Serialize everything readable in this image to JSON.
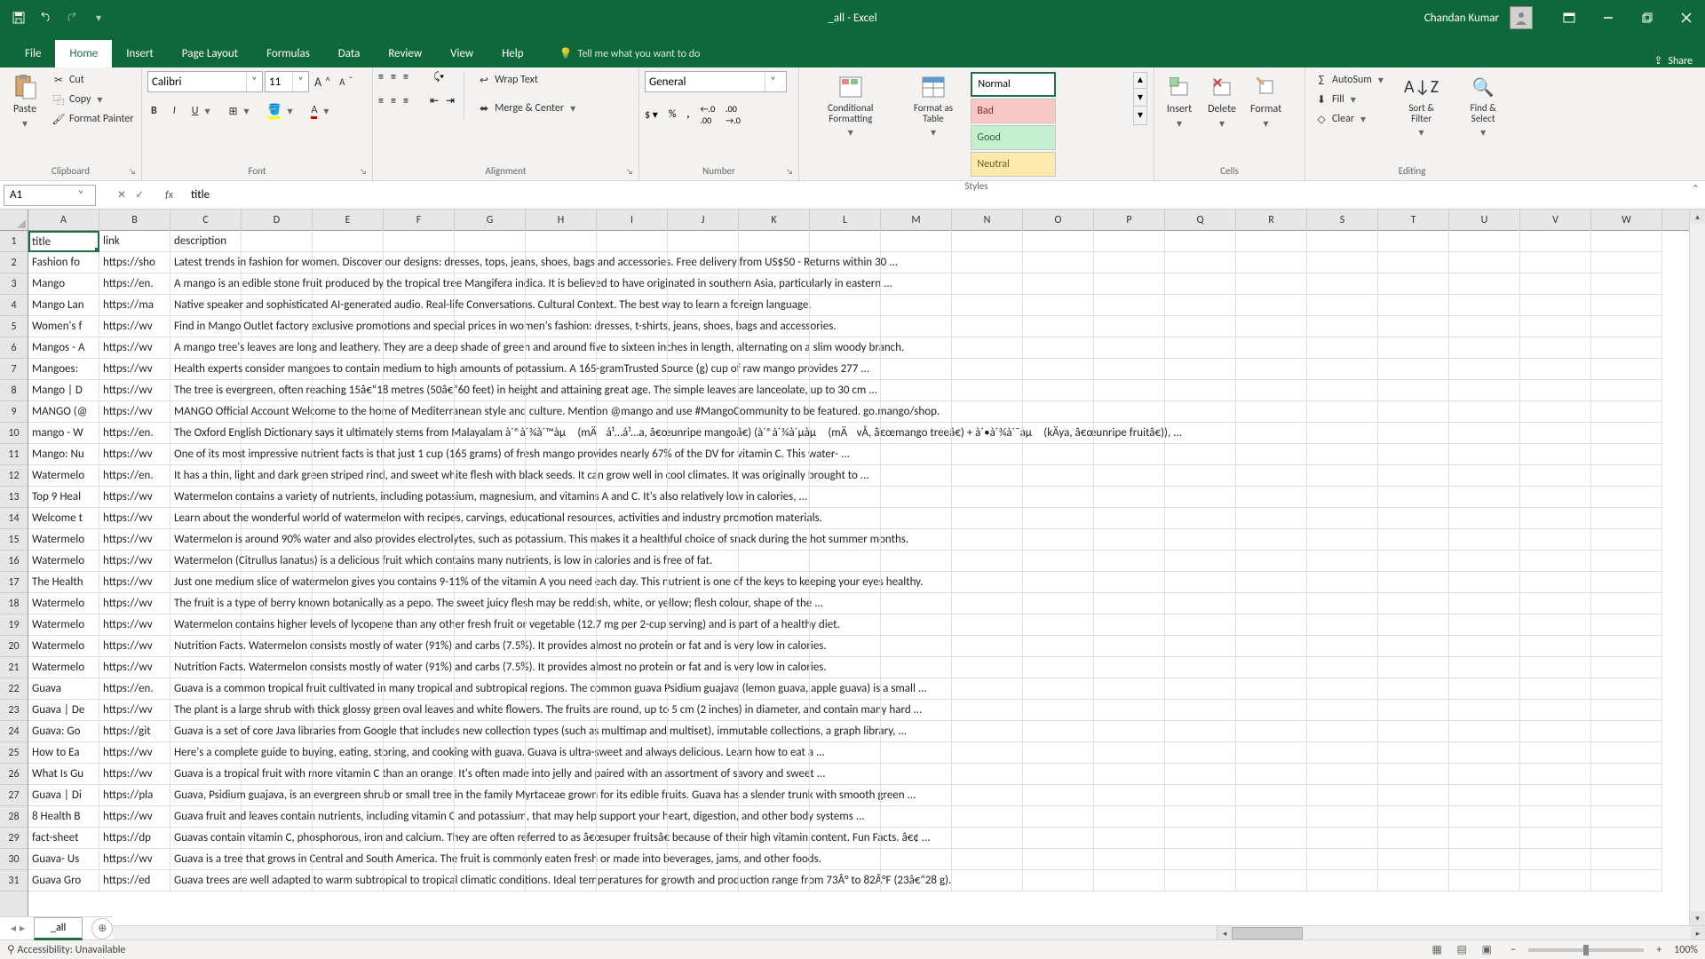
{
  "app": {
    "title": "_all - Excel",
    "user": "Chandan Kumar"
  },
  "tabs": [
    "File",
    "Home",
    "Insert",
    "Page Layout",
    "Formulas",
    "Data",
    "Review",
    "View",
    "Help"
  ],
  "active_tab": "Home",
  "tellme": "Tell me what you want to do",
  "share": "Share",
  "ribbon": {
    "clipboard": {
      "paste": "Paste",
      "cut": "Cut",
      "copy": "Copy",
      "fp": "Format Painter",
      "label": "Clipboard"
    },
    "font": {
      "name": "Calibri",
      "size": "11",
      "label": "Font"
    },
    "alignment": {
      "wrap": "Wrap Text",
      "merge": "Merge & Center",
      "label": "Alignment"
    },
    "number": {
      "format": "General",
      "label": "Number"
    },
    "styles": {
      "cf": "Conditional Formatting",
      "fat": "Format as Table",
      "normal": "Normal",
      "bad": "Bad",
      "good": "Good",
      "neutral": "Neutral",
      "label": "Styles"
    },
    "cells": {
      "insert": "Insert",
      "delete": "Delete",
      "format": "Format",
      "label": "Cells"
    },
    "editing": {
      "autosum": "AutoSum",
      "fill": "Fill",
      "clear": "Clear",
      "sort": "Sort & Filter",
      "find": "Find & Select",
      "label": "Editing"
    }
  },
  "namebox": "A1",
  "formula": "title",
  "columns": [
    "A",
    "B",
    "C",
    "D",
    "E",
    "F",
    "G",
    "H",
    "I",
    "J",
    "K",
    "L",
    "M",
    "N",
    "O",
    "P",
    "Q",
    "R",
    "S",
    "T",
    "U",
    "V",
    "W"
  ],
  "rows": [
    {
      "n": "1",
      "a": "title",
      "b": "link",
      "c": "description"
    },
    {
      "n": "2",
      "a": "Fashion fo",
      "b": "https://sho",
      "c": "Latest trends in fashion for women. Discover our designs: dresses, tops, jeans, shoes, bags and accessories. Free delivery from US$50 - Returns within 30 ..."
    },
    {
      "n": "3",
      "a": "Mango",
      "b": "https://en.",
      "c": "A mango is an edible stone fruit produced by the tropical tree Mangifera indica. It is believed to have originated in southern Asia, particularly in eastern ..."
    },
    {
      "n": "4",
      "a": "Mango Lan",
      "b": "https://ma",
      "c": "Native speaker and sophisticated AI-generated audio. Real-life Conversations. Cultural Context. The best way to learn a foreign language."
    },
    {
      "n": "5",
      "a": "Women's f",
      "b": "https://wv",
      "c": "Find in Mango Outlet factory exclusive promotions and special prices in women's fashion: dresses, t-shirts, jeans, shoes, bags and accessories."
    },
    {
      "n": "6",
      "a": "Mangos - A",
      "b": "https://wv",
      "c": "A mango tree's leaves are long and leathery. They are a deep shade of green and around five to sixteen inches in length, alternating on a slim woody branch."
    },
    {
      "n": "7",
      "a": "Mangoes:",
      "b": "https://wv",
      "c": "Health experts consider mangoes to contain medium to high amounts of potassium. A 165-gramTrusted Source (g) cup of raw mango provides 277 ..."
    },
    {
      "n": "8",
      "a": "Mango | D",
      "b": "https://wv",
      "c": "The tree is evergreen, often reaching 15â€“18 metres (50â€“60 feet) in height and attaining great age. The simple leaves are lanceolate, up to 30 cm ..."
    },
    {
      "n": "9",
      "a": "MANGO (@",
      "b": "https://wv",
      "c": "MANGO Official Account Welcome to the home of Mediterranean style and culture. Mention @mango and use #MangoCommunity to be featured. go.mango/shop."
    },
    {
      "n": "10",
      "a": "mango - W",
      "b": "https://en.",
      "c": "The Oxford English Dictionary says it ultimately stems from Malayalam à´®à´¾à´™àµ (mÄá¹…á¹…a, â€œunripe mangoâ€) (à´®à´¾à´µàµ (mÄvÅ­, â€œmango treeâ€) + à´•à´¾à´¯àµ (kÄya, â€œunripe fruitâ€)), ..."
    },
    {
      "n": "11",
      "a": "Mango: Nu",
      "b": "https://wv",
      "c": "One of its most impressive nutrient facts is that just 1 cup (165 grams) of fresh mango provides nearly 67% of the DV for vitamin C. This water- ..."
    },
    {
      "n": "12",
      "a": "Watermelo",
      "b": "https://en.",
      "c": "It has a thin, light and dark green striped rind, and sweet white flesh with black seeds. It can grow well in cool climates. It was originally brought to ..."
    },
    {
      "n": "13",
      "a": "Top 9 Heal",
      "b": "https://wv",
      "c": "Watermelon contains a variety of nutrients, including potassium, magnesium, and vitamins A and C. It's also relatively low in calories, ..."
    },
    {
      "n": "14",
      "a": "Welcome t",
      "b": "https://wv",
      "c": "Learn about the wonderful world of watermelon with recipes, carvings, educational resources, activities and industry promotion materials."
    },
    {
      "n": "15",
      "a": "Watermelo",
      "b": "https://wv",
      "c": "Watermelon is around 90% water and also provides electrolytes, such as potassium. This makes it a healthful choice of snack during the hot summer months."
    },
    {
      "n": "16",
      "a": "Watermelo",
      "b": "https://wv",
      "c": "Watermelon (Citrullus lanatus) is a delicious fruit which contains many nutrients, is low in calories and is free of fat."
    },
    {
      "n": "17",
      "a": "The Health",
      "b": "https://wv",
      "c": "Just one medium slice of watermelon gives you contains 9-11% of the vitamin A you need each day. This nutrient is one of the keys to keeping your eyes healthy."
    },
    {
      "n": "18",
      "a": "Watermelo",
      "b": "https://wv",
      "c": "The fruit is a type of berry known botanically as a pepo. The sweet juicy flesh may be reddish, white, or yellow; flesh colour, shape of the ..."
    },
    {
      "n": "19",
      "a": "Watermelo",
      "b": "https://wv",
      "c": "Watermelon contains higher levels of lycopene than any other fresh fruit or vegetable (12.7 mg per 2-cup serving) and is part of a healthy diet."
    },
    {
      "n": "20",
      "a": "Watermelo",
      "b": "https://wv",
      "c": "Nutrition Facts. Watermelon consists mostly of water (91%) and carbs (7.5%). It provides almost no protein or fat and is very low in calories."
    },
    {
      "n": "21",
      "a": "Watermelo",
      "b": "https://wv",
      "c": "Nutrition Facts. Watermelon consists mostly of water (91%) and carbs (7.5%). It provides almost no protein or fat and is very low in calories."
    },
    {
      "n": "22",
      "a": "Guava",
      "b": "https://en.",
      "c": "Guava is a common tropical fruit cultivated in many tropical and subtropical regions. The common guava Psidium guajava (lemon guava, apple guava) is a small ..."
    },
    {
      "n": "23",
      "a": "Guava | De",
      "b": "https://wv",
      "c": "The plant is a large shrub with thick glossy green oval leaves and white flowers. The fruits are round, up to 5 cm (2 inches) in diameter, and contain many hard ..."
    },
    {
      "n": "24",
      "a": "Guava: Go",
      "b": "https://git",
      "c": "Guava is a set of core Java libraries from Google that includes new collection types (such as multimap and multiset), immutable collections, a graph library, ..."
    },
    {
      "n": "25",
      "a": "How to Ea",
      "b": "https://wv",
      "c": "Here's a complete guide to buying, eating, storing, and cooking with guava. Guava is ultra-sweet and always delicious. Learn how to eat a ..."
    },
    {
      "n": "26",
      "a": "What Is Gu",
      "b": "https://wv",
      "c": "Guava is a tropical fruit with more vitamin C than an orange. It's often made into jelly and paired with an assortment of savory and sweet ..."
    },
    {
      "n": "27",
      "a": "Guava | Di",
      "b": "https://pla",
      "c": "Guava, Psidium guajava, is an evergreen shrub or small tree in the family Myrtaceae grown for its edible fruits. Guava has a slender trunk with smooth green ..."
    },
    {
      "n": "28",
      "a": "8 Health B",
      "b": "https://wv",
      "c": "Guava fruit and leaves contain nutrients, including vitamin C and potassium, that may help support your heart, digestion, and other body systems ..."
    },
    {
      "n": "29",
      "a": "fact-sheet",
      "b": "https://dp",
      "c": "Guavas contain vitamin C, phosphorous, iron and calcium. They are often referred to as â€œsuper fruitsâ€ because of their high vitamin content. Fun Facts. â€¢ ..."
    },
    {
      "n": "30",
      "a": "Guava- Us",
      "b": "https://wv",
      "c": "Guava is a tree that grows in Central and South America. The fruit is commonly eaten fresh or made into beverages, jams, and other foods."
    },
    {
      "n": "31",
      "a": "Guava Gro",
      "b": "https://ed",
      "c": "Guava trees are well adapted to warm subtropical to tropical climatic conditions. Ideal temperatures for growth and production range from 73Â° to 82Â°F (23â€“28 g)."
    }
  ],
  "sheet": {
    "name": "_all"
  },
  "status": {
    "acc": "Accessibility: Unavailable",
    "zoom": "100%"
  }
}
